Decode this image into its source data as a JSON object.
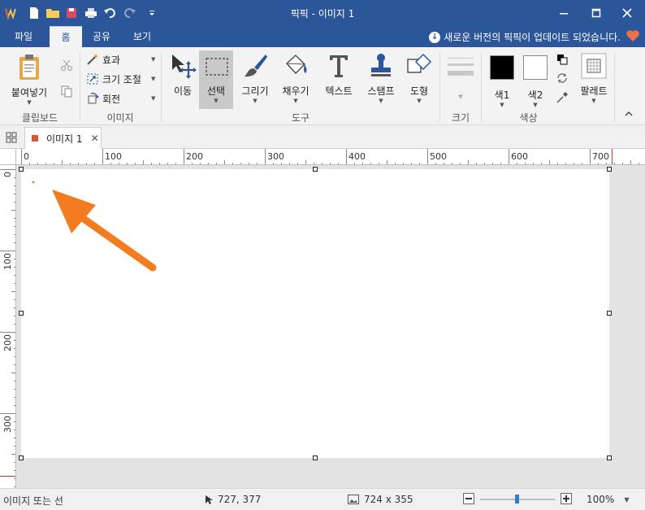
{
  "window": {
    "title": "픽픽 - 이미지 1"
  },
  "menu_tabs": [
    {
      "label": "파일"
    },
    {
      "label": "홈"
    },
    {
      "label": "공유"
    },
    {
      "label": "보기"
    }
  ],
  "update_notice": "새로운 버전의 픽픽이 업데이트 되었습니다.",
  "ribbon": {
    "clipboard": {
      "paste_label": "붙여넣기",
      "group_label": "클립보드"
    },
    "image": {
      "effect_label": "효과",
      "resize_label": "크기 조절",
      "rotate_label": "회전",
      "group_label": "이미지"
    },
    "tools": {
      "move_label": "이동",
      "select_label": "선택",
      "draw_label": "그리기",
      "fill_label": "채우기",
      "text_label": "텍스트",
      "stamp_label": "스탬프",
      "shape_label": "도형",
      "group_label": "도구"
    },
    "size": {
      "group_label": "크기"
    },
    "color": {
      "color1_label": "색1",
      "color2_label": "색2",
      "palette_label": "팔레트",
      "group_label": "색상",
      "color1": "#000000",
      "color2": "#ffffff"
    }
  },
  "document_tab": {
    "label": "이미지 1"
  },
  "ruler": {
    "h_labels": [
      "0",
      "100",
      "200",
      "300",
      "400",
      "500",
      "600",
      "700"
    ],
    "v_labels": [
      "0",
      "100",
      "200",
      "300"
    ]
  },
  "status": {
    "hint": "이미지 또는 선",
    "cursor": "727, 377",
    "image_size": "724 x 355",
    "zoom": "100%"
  },
  "colors": {
    "title_bar": "#2b579a",
    "arrow": "#f47c20",
    "heart": "#e8704a"
  }
}
